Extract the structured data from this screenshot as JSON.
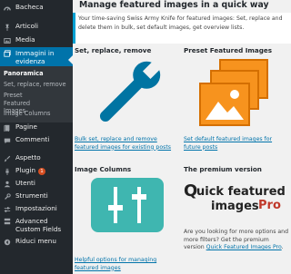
{
  "sidebar": {
    "items": [
      {
        "label": "Bacheca",
        "icon": "dashboard-icon"
      },
      {
        "label": "Articoli",
        "icon": "pin-icon"
      },
      {
        "label": "Media",
        "icon": "media-icon"
      },
      {
        "label": "Immagini in evidenza",
        "icon": "images-icon"
      },
      {
        "label": "Pagine",
        "icon": "pages-icon"
      },
      {
        "label": "Commenti",
        "icon": "comments-icon"
      },
      {
        "label": "Aspetto",
        "icon": "brush-icon"
      },
      {
        "label": "Plugin",
        "icon": "plug-icon",
        "badge": "1"
      },
      {
        "label": "Utenti",
        "icon": "users-icon"
      },
      {
        "label": "Strumenti",
        "icon": "tools-icon"
      },
      {
        "label": "Impostazioni",
        "icon": "settings-icon"
      },
      {
        "label": "Advanced Custom Fields",
        "icon": "acf-icon"
      },
      {
        "label": "Riduci menu",
        "icon": "collapse-icon"
      }
    ],
    "submenu": [
      {
        "label": "Panoramica"
      },
      {
        "label": "Set, replace, remove"
      },
      {
        "label": "Preset Featured Images"
      },
      {
        "label": "Image Columns"
      }
    ],
    "colors": {
      "bg": "#23282d",
      "active": "#0073aa",
      "submenu_bg": "#32373c"
    }
  },
  "main": {
    "title": "Manage featured images in a quick way",
    "intro": "Your time-saving Swiss Army Knife for featured images: Set, replace and delete them in bulk, set default images, get overview lists.",
    "boxes": [
      {
        "title": "Set, replace, remove",
        "link": "Bulk set, replace and remove featured images for existing posts",
        "icon": "wrench-icon"
      },
      {
        "title": "Preset Featured Images",
        "link": "Set default featured images for future posts",
        "icon": "images-stack-icon"
      },
      {
        "title": "Image Columns",
        "link": "Helpful options for managing featured images",
        "icon": "sliders-icon"
      },
      {
        "title": "The premium version",
        "text_before": "Are you looking for more options and more filters? Get the premium version ",
        "link": "Quick Featured Images Pro",
        "text_after": ".",
        "logo_main": "uick featured",
        "logo_q": "Q",
        "logo_line2": "images",
        "logo_pro": "Pro"
      }
    ],
    "colors": {
      "link": "#0073aa",
      "wrench": "#0074a2",
      "images_fill": "#f7931e",
      "sliders": "#3fb6b0"
    }
  }
}
